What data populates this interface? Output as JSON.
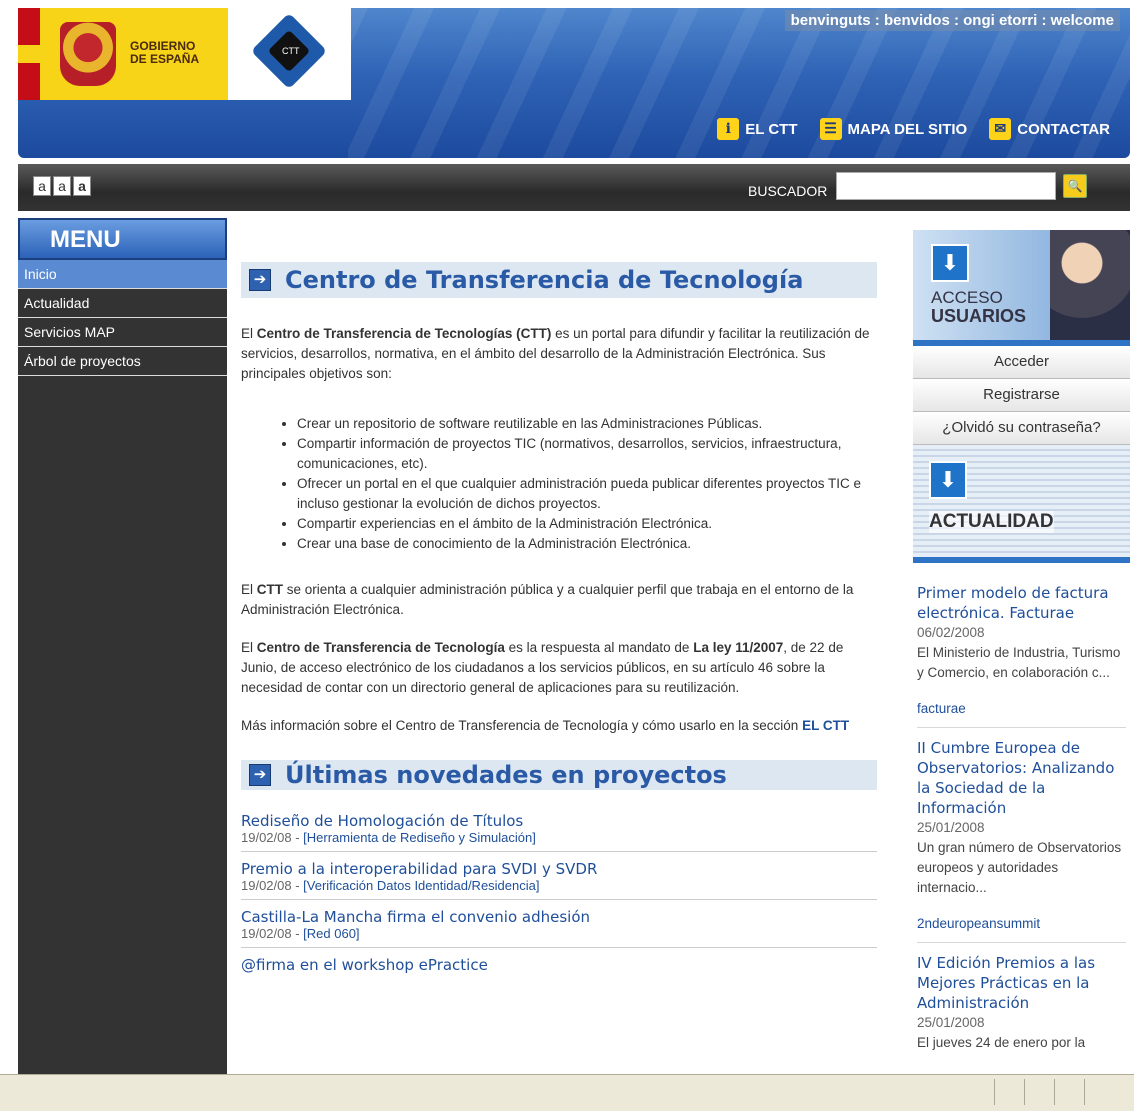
{
  "header": {
    "gobierno_line1": "GOBIERNO",
    "gobierno_line2": "DE ESPAÑA",
    "ctt_logo_text": "CTT",
    "welcome": "benvinguts : benvidos : ongi etorri : welcome",
    "nav": [
      {
        "icon": "info-icon",
        "label": "EL CTT"
      },
      {
        "icon": "sitemap-icon",
        "label": "MAPA DEL SITIO"
      },
      {
        "icon": "mail-icon",
        "label": "CONTACTAR"
      }
    ]
  },
  "toolbar": {
    "font_sizes": [
      "a",
      "a",
      "a"
    ],
    "search_label": "BUSCADOR",
    "search_value": ""
  },
  "menu": {
    "title": "MENU",
    "items": [
      "Inicio",
      "Actualidad",
      "Servicios MAP",
      "Árbol de proyectos"
    ],
    "active_index": 0
  },
  "main": {
    "title": "Centro de Transferencia de Tecnología",
    "intro": {
      "p1": "El ",
      "b1": "Centro de Transferencia de Tecnologías (CTT)",
      "p2": " es un portal para difundir y facilitar la reutilización de servicios, desarrollos, normativa, en el ámbito del desarrollo de la Administración Electrónica. Sus principales objetivos son:"
    },
    "bullets": [
      "Crear un repositorio de software reutilizable en las Administraciones Públicas.",
      "Compartir información de proyectos TIC (normativos, desarrollos, servicios, infraestructura, comunicaciones, etc).",
      "Ofrecer un portal en el que cualquier administración pueda publicar diferentes proyectos TIC e incluso gestionar la evolución de dichos proyectos.",
      "Compartir experiencias en el ámbito de la Administración Electrónica.",
      "Crear una base de conocimiento de la Administración Electrónica."
    ],
    "para2": {
      "p1": "El ",
      "b1": "CTT",
      "p2": " se orienta a cualquier administración pública y a cualquier perfil que trabaja en el entorno de la Administración Electrónica."
    },
    "para3": {
      "p1": "El ",
      "b1": "Centro de Transferencia de Tecnología",
      "p2": " es la respuesta al mandato de ",
      "b2": "La ley 11/2007",
      "p3": ", de 22 de Junio, de acceso electrónico de los ciudadanos a los servicios públicos, en su artículo 46 sobre la necesidad de contar con un directorio general de aplicaciones para su reutilización."
    },
    "para4": {
      "p1": "Más información sobre el Centro de Transferencia de Tecnología y cómo usarlo en la sección ",
      "link": "EL CTT"
    },
    "news_title": "Últimas novedades en proyectos",
    "news": [
      {
        "title": "Rediseño de Homologación de Títulos",
        "date": "19/02/08",
        "sep": " - ",
        "project": "[Herramienta de Rediseño y Simulación]"
      },
      {
        "title": "Premio a la interoperabilidad para SVDI y SVDR",
        "date": "19/02/08",
        "sep": " - ",
        "project": "[Verificación Datos Identidad/Residencia]"
      },
      {
        "title": "Castilla-La Mancha firma el convenio adhesión",
        "date": "19/02/08",
        "sep": " - ",
        "project": "[Red 060]"
      },
      {
        "title": "@firma en el workshop ePractice",
        "date": "",
        "sep": "",
        "project": ""
      }
    ]
  },
  "right": {
    "acceso_line1": "ACCESO",
    "acceso_line2": "USUARIOS",
    "buttons": [
      "Acceder",
      "Registrarse",
      "¿Olvidó su contraseña?"
    ],
    "actualidad": "ACTUALIDAD",
    "news": [
      {
        "title": "Primer modelo de factura electrónica. Facturae",
        "date": "06/02/2008",
        "desc": "El Ministerio de Industria, Turismo y Comercio, en colaboración c...",
        "tag": "facturae"
      },
      {
        "title": "II Cumbre Europea de Observatorios: Analizando la Sociedad de la Información",
        "date": "25/01/2008",
        "desc": "Un gran número de Observatorios europeos y autoridades internacio...",
        "tag": "2ndeuropeansummit"
      },
      {
        "title": "IV Edición Premios a las Mejores Prácticas en la Administración",
        "date": "25/01/2008",
        "desc": "El jueves 24 de enero por la",
        "tag": ""
      }
    ]
  }
}
